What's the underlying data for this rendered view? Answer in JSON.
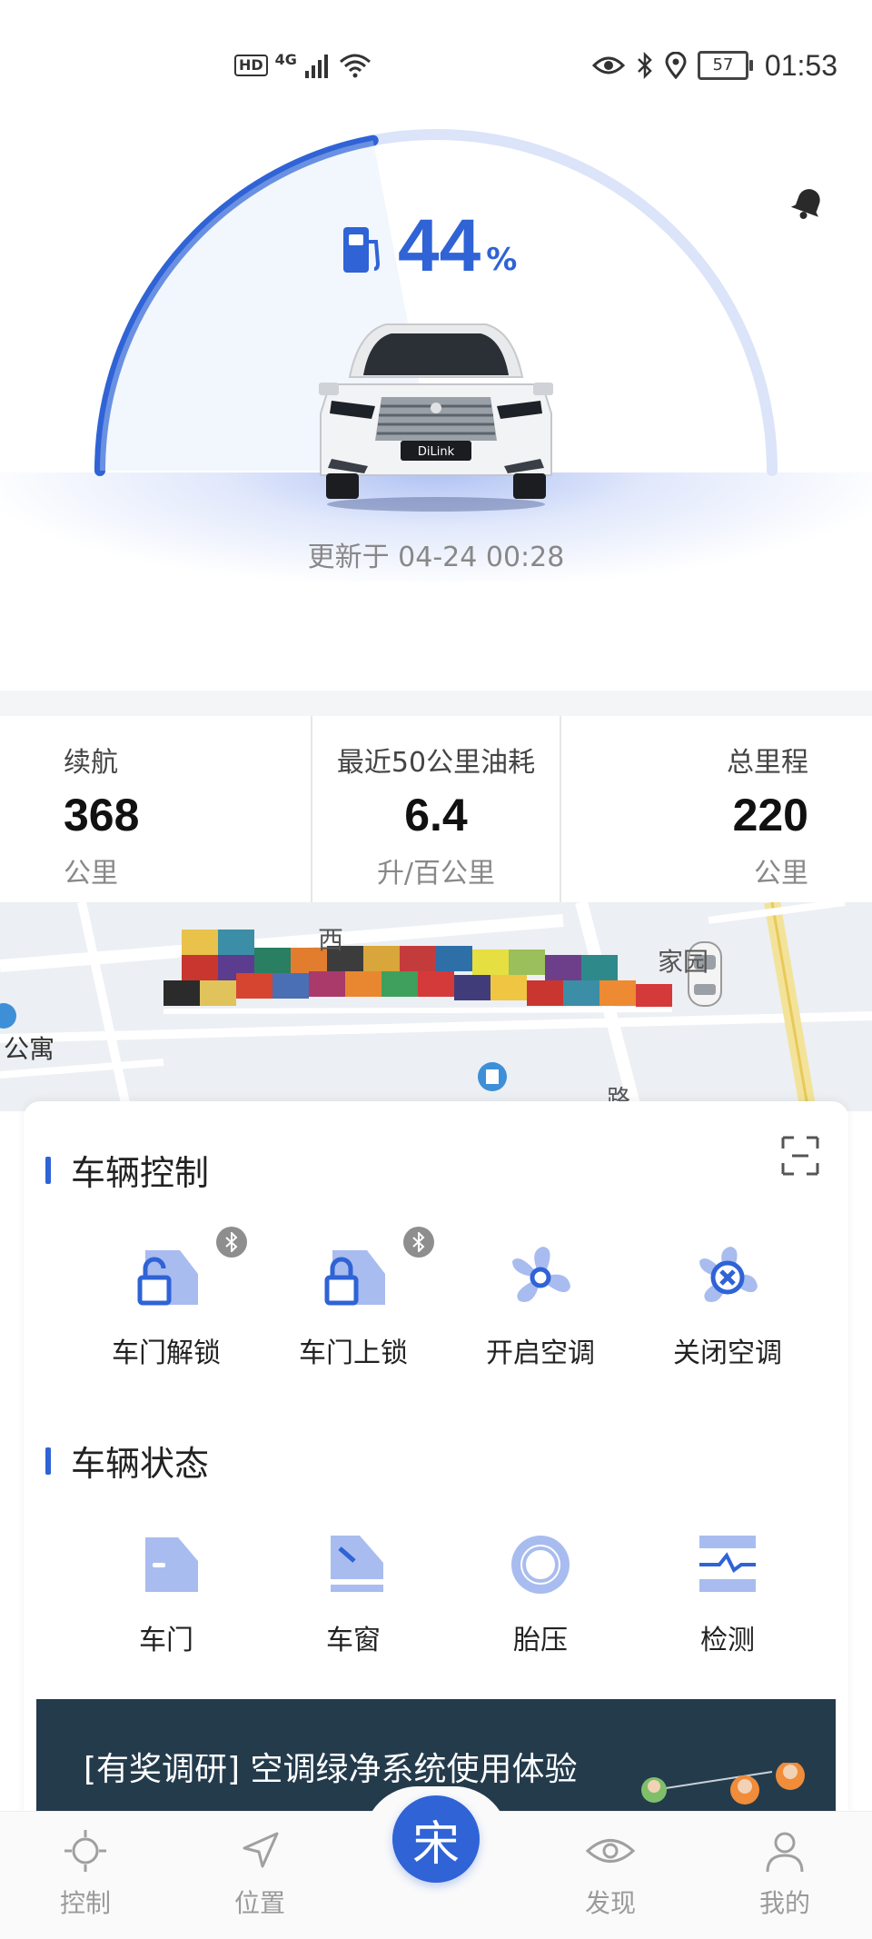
{
  "status_bar": {
    "hd": "HD",
    "network": "4G",
    "battery": "57",
    "time": "01:53"
  },
  "vehicle": {
    "fuel_percent": "44",
    "fuel_unit": "%",
    "fuel_level_fraction": 0.44,
    "plate_badge": "DiLink",
    "updated": "更新于 04-24 00:28"
  },
  "stats": [
    {
      "label": "续航",
      "value": "368",
      "unit": "公里"
    },
    {
      "label": "最近50公里油耗",
      "value": "6.4",
      "unit": "升/百公里"
    },
    {
      "label": "总里程",
      "value": "220",
      "unit": "公里"
    }
  ],
  "map": {
    "labels": [
      "西",
      "家园",
      "公寓",
      "路"
    ]
  },
  "control": {
    "title": "车辆控制",
    "items": [
      {
        "label": "车门解锁",
        "icon": "door-unlock-icon"
      },
      {
        "label": "车门上锁",
        "icon": "door-lock-icon"
      },
      {
        "label": "开启空调",
        "icon": "fan-icon"
      },
      {
        "label": "关闭空调",
        "icon": "fan-off-icon"
      }
    ]
  },
  "status": {
    "title": "车辆状态",
    "items": [
      {
        "label": "车门",
        "icon": "door-icon"
      },
      {
        "label": "车窗",
        "icon": "window-icon"
      },
      {
        "label": "胎压",
        "icon": "tire-icon"
      },
      {
        "label": "检测",
        "icon": "diagnostic-icon"
      }
    ]
  },
  "banner": {
    "text": "[有奖调研] 空调绿净系统使用体验"
  },
  "bottom_nav": {
    "items": [
      "控制",
      "位置",
      "发现",
      "我的"
    ],
    "center_glyph": "宋"
  },
  "colors": {
    "accent": "#2f63d6",
    "accent_light": "#dbe4f8",
    "banner_bg": "#243b4c"
  }
}
